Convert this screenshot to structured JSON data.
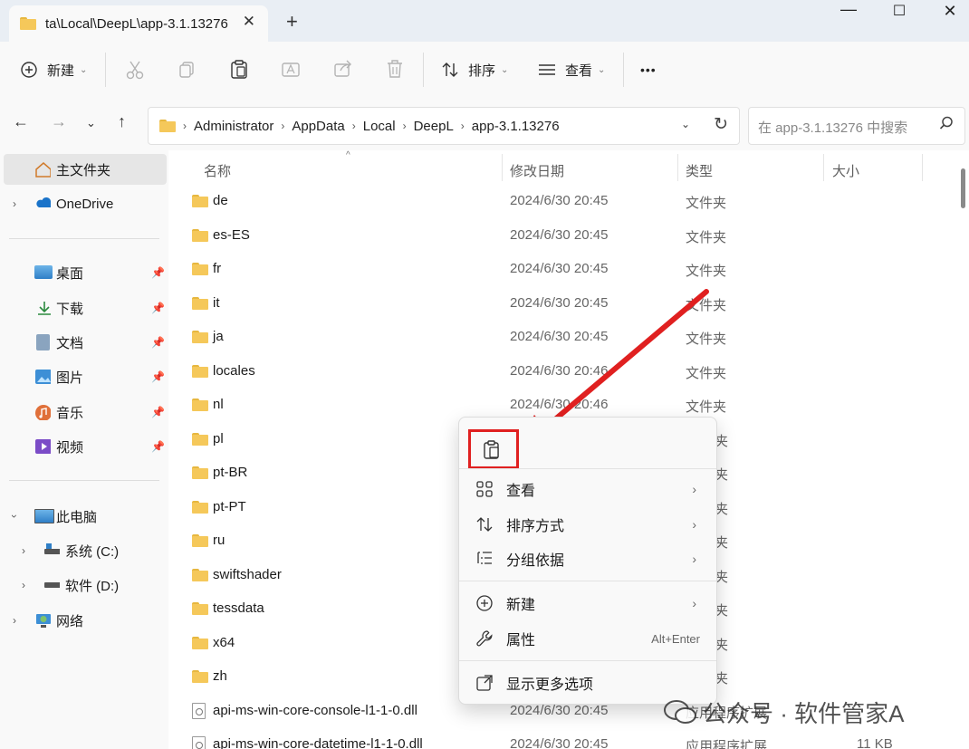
{
  "tab": {
    "title": "ta\\Local\\DeepL\\app-3.1.13276",
    "close": "✕",
    "new": "+"
  },
  "window": {
    "minimize": "—",
    "maximize": "☐",
    "close": "✕"
  },
  "toolbar": {
    "new_label": "新建",
    "sort_label": "排序",
    "view_label": "查看",
    "more_label": "•••"
  },
  "address": {
    "crumbs": [
      "Administrator",
      "AppData",
      "Local",
      "DeepL",
      "app-3.1.13276"
    ],
    "search_placeholder": "在 app-3.1.13276 中搜索"
  },
  "sidebar": {
    "home": "主文件夹",
    "onedrive": "OneDrive",
    "quick": [
      "桌面",
      "下载",
      "文档",
      "图片",
      "音乐",
      "视频"
    ],
    "this_pc": "此电脑",
    "drives": [
      "系统 (C:)",
      "软件 (D:)"
    ],
    "network": "网络"
  },
  "columns": {
    "name": "名称",
    "date": "修改日期",
    "type": "类型",
    "size": "大小"
  },
  "files": [
    {
      "name": "de",
      "date": "2024/6/30 20:45",
      "type": "文件夹",
      "size": ""
    },
    {
      "name": "es-ES",
      "date": "2024/6/30 20:45",
      "type": "文件夹",
      "size": ""
    },
    {
      "name": "fr",
      "date": "2024/6/30 20:45",
      "type": "文件夹",
      "size": ""
    },
    {
      "name": "it",
      "date": "2024/6/30 20:45",
      "type": "文件夹",
      "size": ""
    },
    {
      "name": "ja",
      "date": "2024/6/30 20:45",
      "type": "文件夹",
      "size": ""
    },
    {
      "name": "locales",
      "date": "2024/6/30 20:46",
      "type": "文件夹",
      "size": ""
    },
    {
      "name": "nl",
      "date": "2024/6/30 20:46",
      "type": "文件夹",
      "size": ""
    },
    {
      "name": "pl",
      "date": "",
      "type": "夹",
      "size": ""
    },
    {
      "name": "pt-BR",
      "date": "",
      "type": "夹",
      "size": ""
    },
    {
      "name": "pt-PT",
      "date": "",
      "type": "夹",
      "size": ""
    },
    {
      "name": "ru",
      "date": "",
      "type": "夹",
      "size": ""
    },
    {
      "name": "swiftshader",
      "date": "",
      "type": "夹",
      "size": ""
    },
    {
      "name": "tessdata",
      "date": "",
      "type": "夹",
      "size": ""
    },
    {
      "name": "x64",
      "date": "",
      "type": "夹",
      "size": ""
    },
    {
      "name": "zh",
      "date": "",
      "type": "夹",
      "size": ""
    },
    {
      "name": "api-ms-win-core-console-l1-1-0.dll",
      "date": "2024/6/30 20:45",
      "type": "应用程序扩展",
      "size": ""
    },
    {
      "name": "api-ms-win-core-datetime-l1-1-0.dll",
      "date": "2024/6/30 20:45",
      "type": "应用程序扩展",
      "size": "11 KB"
    }
  ],
  "context_menu": {
    "view": "查看",
    "sort": "排序方式",
    "group": "分组依据",
    "new": "新建",
    "properties": "属性",
    "properties_shortcut": "Alt+Enter",
    "more": "显示更多选项"
  },
  "watermark": "公众号 · 软件管家A",
  "colors": {
    "highlight": "#e02020",
    "folder": "#f5c85a",
    "selection": "#e6e6e6"
  }
}
